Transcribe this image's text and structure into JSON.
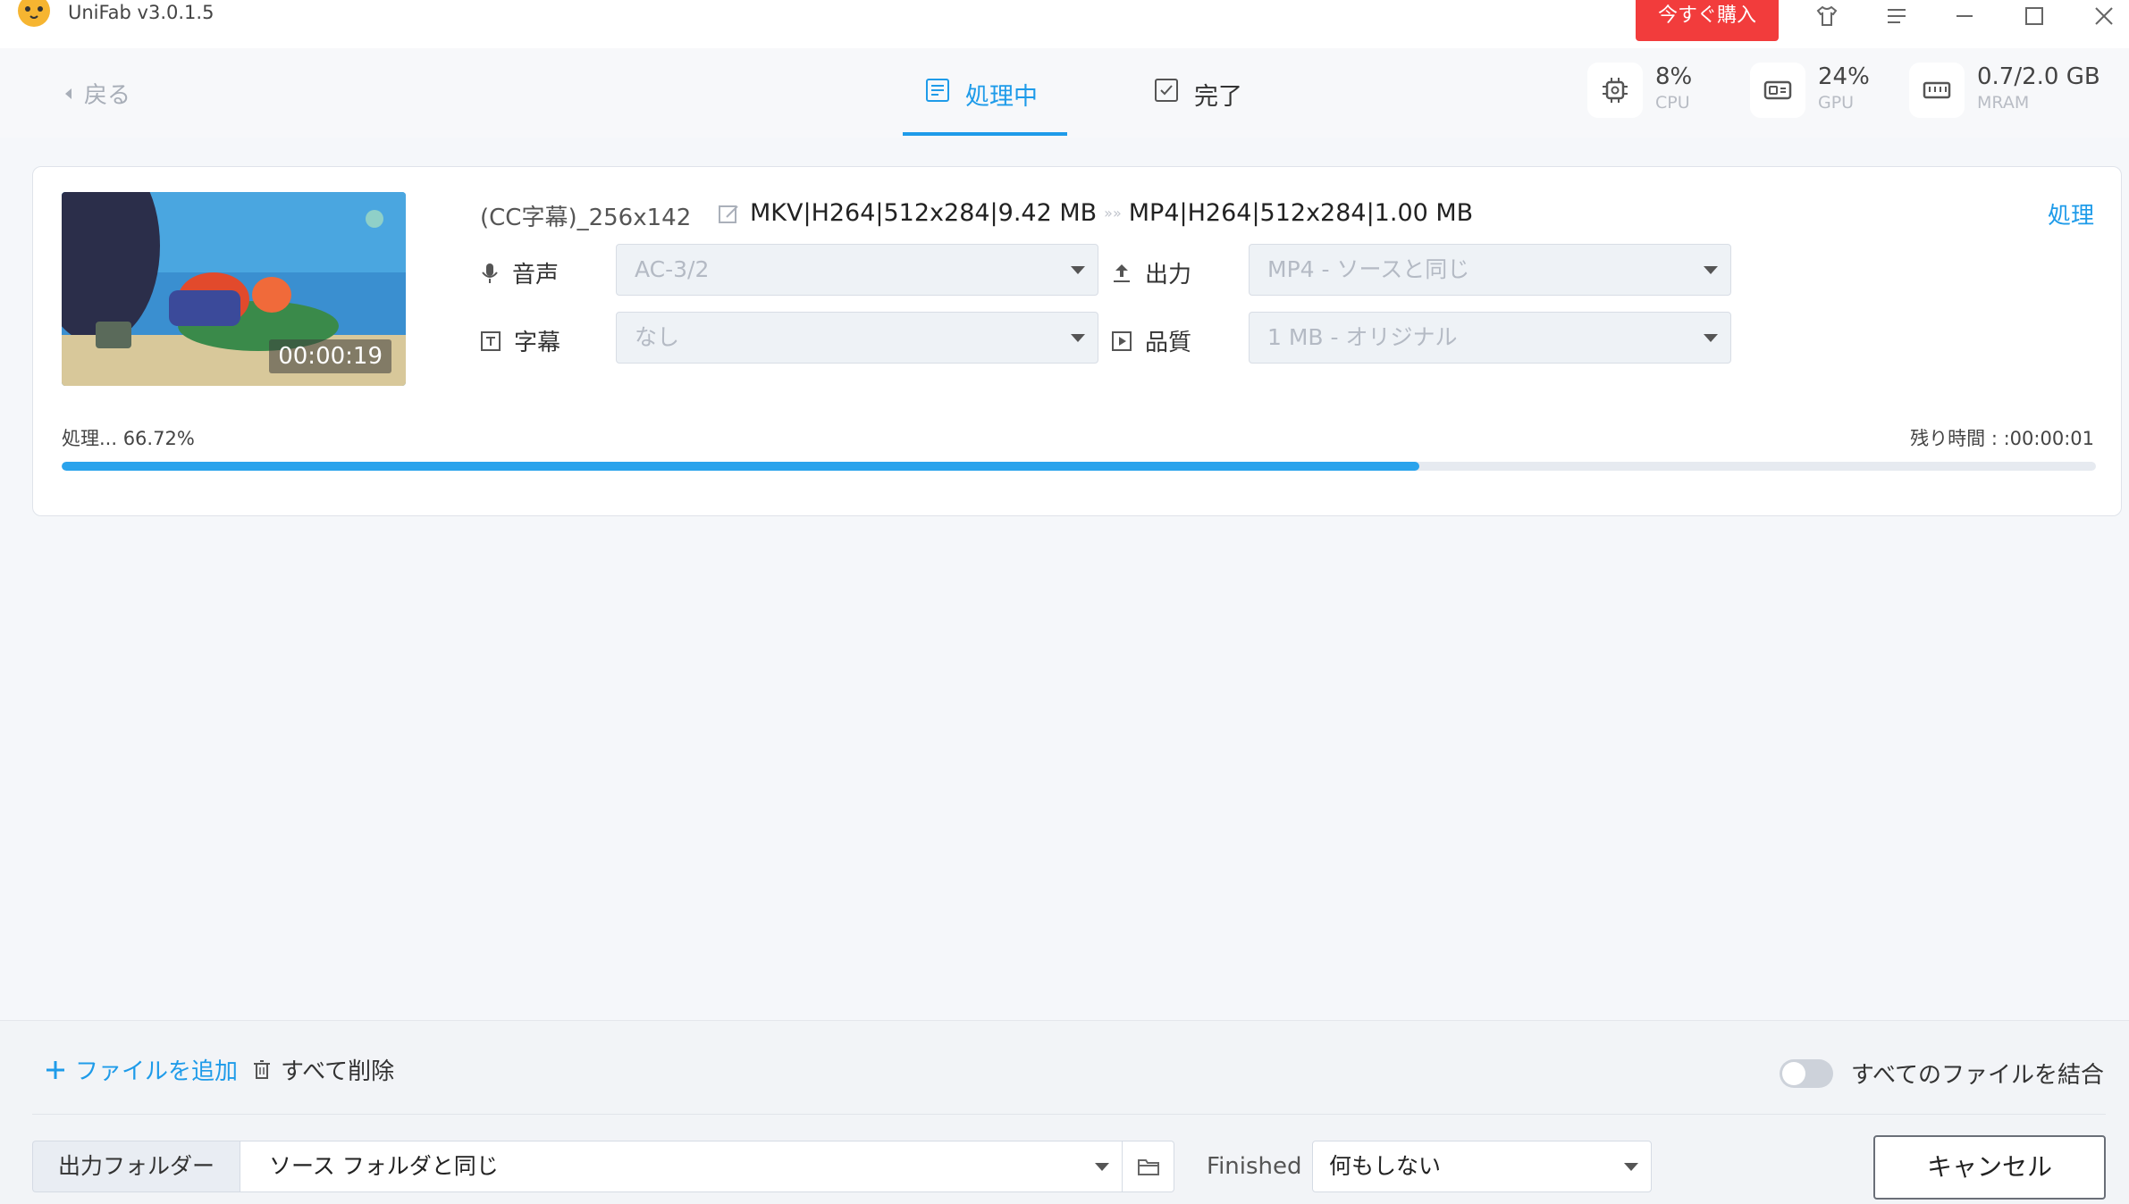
{
  "window": {
    "title": "UniFab v3.0.1.5",
    "buy_label": "今すぐ購入",
    "icons": [
      "cat-logo-icon",
      "shirt-icon",
      "menu-icon",
      "minimize-icon",
      "maximize-icon",
      "close-icon"
    ]
  },
  "nav": {
    "back_label": "戻る",
    "tabs": [
      {
        "label": "処理中",
        "icon": "list-icon",
        "active": true
      },
      {
        "label": "完了",
        "icon": "check-box-icon",
        "active": false
      }
    ],
    "metrics": [
      {
        "value": "8%",
        "label": "CPU",
        "icon": "cpu-icon"
      },
      {
        "value": "24%",
        "label": "GPU",
        "icon": "gpu-icon"
      },
      {
        "value": "0.7/2.0 GB",
        "label": "MRAM",
        "icon": "memory-icon"
      }
    ]
  },
  "task": {
    "duration": "00:00:19",
    "file_name": "(CC字幕)_256x142",
    "source_format": "MKV|H264|512x284|9.42 MB",
    "target_format": "MP4|H264|512x284|1.00 MB",
    "process_label": "処理",
    "audio": {
      "label": "音声",
      "value": "AC-3/2"
    },
    "subtitle": {
      "label": "字幕",
      "value": "なし"
    },
    "output": {
      "label": "出力",
      "value": "MP4 - ソースと同じ"
    },
    "quality": {
      "label": "品質",
      "value": "1 MB - オリジナル"
    },
    "progress_text": "処理... 66.72%",
    "progress_percent": 66.72,
    "remaining_text": "残り時間 : :00:00:01"
  },
  "bottom": {
    "add_files_label": "ファイルを追加",
    "delete_all_label": "すべて削除",
    "merge_label": "すべてのファイルを結合",
    "merge_enabled": false,
    "output_folder_label": "出力フォルダー",
    "output_folder_value": "ソース フォルダと同じ",
    "finished_label": "Finished",
    "finished_value": "何もしない",
    "cancel_label": "キャンセル"
  },
  "colors": {
    "accent": "#1e9be9",
    "buy": "#f23c3c",
    "progress": "#2aa3ec"
  }
}
